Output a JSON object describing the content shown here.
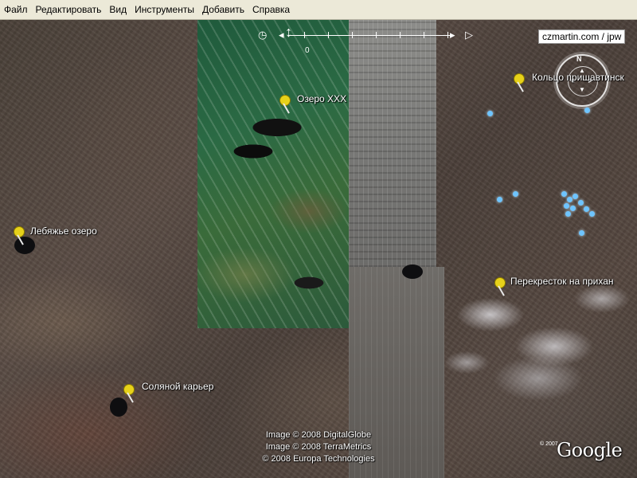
{
  "menu": [
    "Файл",
    "Редактировать",
    "Вид",
    "Инструменты",
    "Добавить",
    "Справка"
  ],
  "nav": {
    "zero_label": "0",
    "compass_north": "N"
  },
  "url_label": "czmartin.com / jpw",
  "placemarks": [
    {
      "label": "Озеро XXX"
    },
    {
      "label": "Кольцо пришавтинск"
    },
    {
      "label": "Лебяжье озеро"
    },
    {
      "label": "Перекресток на прихан"
    },
    {
      "label": "Соляной карьер"
    }
  ],
  "credits": [
    "Image © 2008 DigitalGlobe",
    "Image © 2008 TerraMetrics",
    "© 2008 Europa Technologies"
  ],
  "small_copyright": "© 2007",
  "logo": "Google",
  "colors": {
    "pin_yellow": "#e7d11a",
    "marker_blue": "#6ec4ff",
    "menubar": "#ece9d8"
  }
}
